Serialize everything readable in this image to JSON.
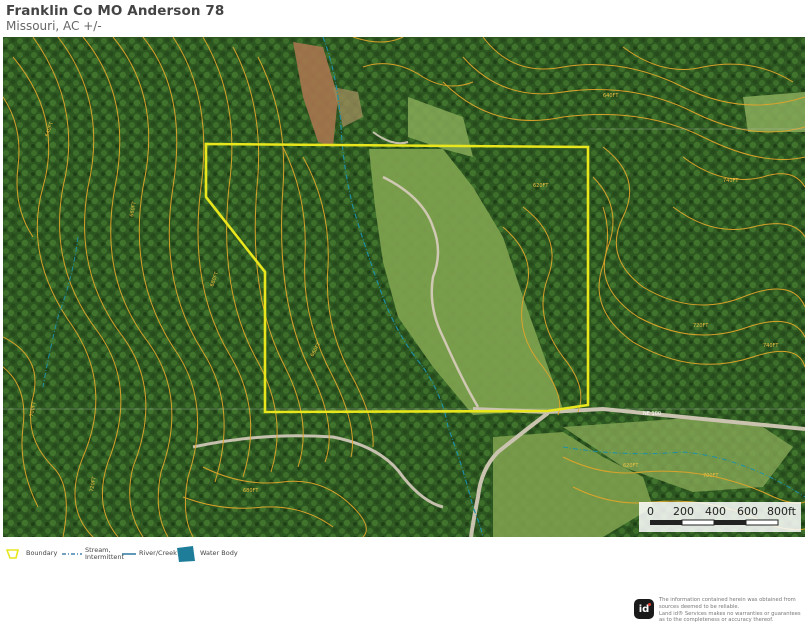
{
  "header": {
    "title": "Franklin Co MO Anderson 78",
    "subtitle": "Missouri,  AC +/-"
  },
  "map": {
    "contour_labels": [
      "640FT",
      "660FT",
      "680FT",
      "700FT",
      "720FT",
      "740FT",
      "620FT"
    ],
    "road_label": "NE 100",
    "colors": {
      "boundary": "#e8e61c",
      "contour": "#e0a52a",
      "stream": "#1e8fa5",
      "forest": "#2f5a22",
      "pasture": "#7aa04a"
    }
  },
  "scale": {
    "ticks": [
      "0",
      "200",
      "400",
      "600",
      "800ft"
    ]
  },
  "legend": {
    "boundary": "Boundary",
    "stream_line1": "Stream,",
    "stream_line2": "Intermittent",
    "river": "River/Creek",
    "water": "Water Body"
  },
  "footer": {
    "logo_text": "id",
    "disclaimer_lines": [
      "The information contained herein was obtained from",
      "sources deemed to be reliable.",
      "Land id® Services makes no warranties or guarantees",
      "as to the completeness or accuracy thereof."
    ]
  }
}
